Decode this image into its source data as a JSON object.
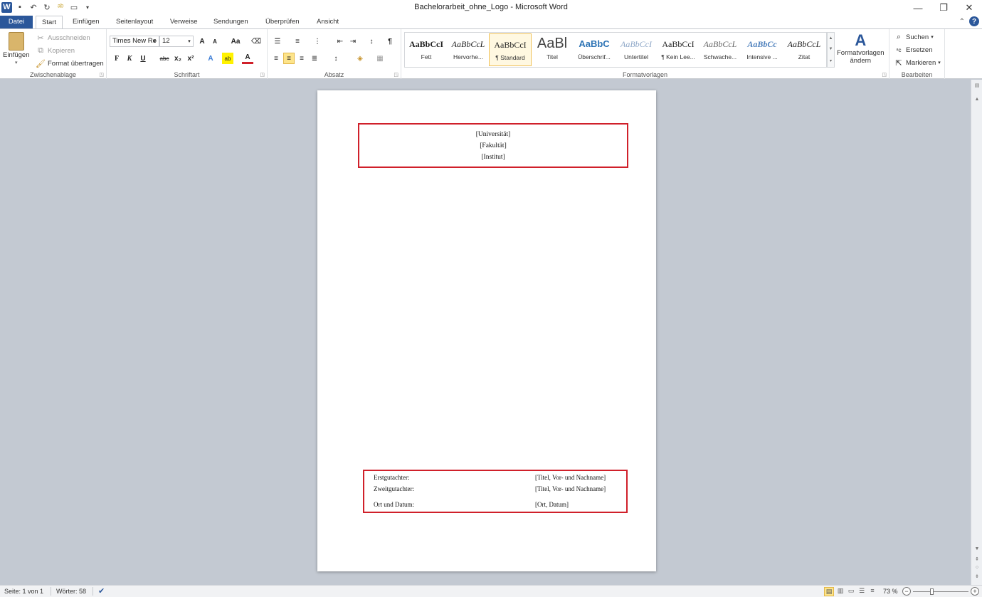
{
  "window": {
    "title": "Bachelorarbeit_ohne_Logo  -  Microsoft Word",
    "minimize": "—",
    "restore": "❐",
    "close": "✕"
  },
  "tabs": {
    "file": "Datei",
    "items": [
      "Start",
      "Einfügen",
      "Seitenlayout",
      "Verweise",
      "Sendungen",
      "Überprüfen",
      "Ansicht"
    ],
    "active": "Start"
  },
  "clipboard": {
    "paste": "Einfügen",
    "cut": "Ausschneiden",
    "copy": "Kopieren",
    "format_painter": "Format übertragen",
    "label": "Zwischenablage"
  },
  "font": {
    "name": "Times New Ro",
    "size": "12",
    "grow": "A",
    "shrink": "A",
    "case": "Aa",
    "bold": "F",
    "italic": "K",
    "underline": "U",
    "strike": "abc",
    "subscript": "x₂",
    "superscript": "x²",
    "label": "Schriftart"
  },
  "paragraph": {
    "label": "Absatz",
    "pilcrow": "¶"
  },
  "styles": {
    "label": "Formatvorlagen",
    "items": [
      {
        "preview": "AaBbCcI",
        "name": "Fett"
      },
      {
        "preview": "AaBbCcL",
        "name": "Hervorhe..."
      },
      {
        "preview": "AaBbCcI",
        "name": "¶ Standard"
      },
      {
        "preview": "AaBl",
        "name": "Titel"
      },
      {
        "preview": "AaBbC",
        "name": "Überschrif..."
      },
      {
        "preview": "AaBbCcI",
        "name": "Untertitel"
      },
      {
        "preview": "AaBbCcI",
        "name": "¶ Kein Lee..."
      },
      {
        "preview": "AaBbCcL",
        "name": "Schwache..."
      },
      {
        "preview": "AaBbCc",
        "name": "Intensive ..."
      },
      {
        "preview": "AaBbCcL",
        "name": "Zitat"
      }
    ],
    "current": "¶ Standard",
    "change_line1": "Formatvorlagen",
    "change_line2": "ändern"
  },
  "editing": {
    "label": "Bearbeiten",
    "find": "Suchen",
    "replace": "Ersetzen",
    "select": "Markieren"
  },
  "document": {
    "header_lines": [
      "[Universität]",
      "[Fakultät]",
      "[Institut]"
    ],
    "rows": [
      {
        "label": "Erstgutachter:",
        "value": "[Titel, Vor- und Nachname]"
      },
      {
        "label": "Zweitgutachter:",
        "value": "[Titel, Vor- und Nachname]"
      },
      {
        "label": "Ort und Datum:",
        "value": "[Ort, Datum]"
      }
    ]
  },
  "status": {
    "page": "Seite: 1 von 1",
    "words": "Wörter: 58",
    "zoom": "73 %",
    "zoom_level": 0.73
  },
  "colors": {
    "accent": "#2b579a",
    "highlight": "#fde48a",
    "box_border": "#d0202a"
  }
}
